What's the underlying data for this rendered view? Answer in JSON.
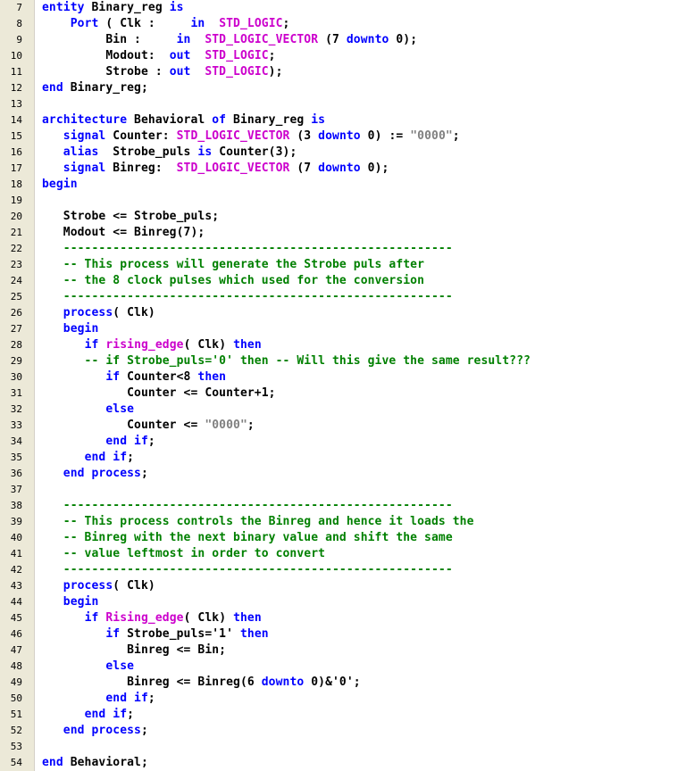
{
  "colors": {
    "keyword": "#0000ff",
    "type": "#cc00cc",
    "function": "#cc00cc",
    "string": "#808080",
    "comment": "#008000",
    "identifier": "#000000",
    "gutter_bg": "#ece9d8"
  },
  "editor": {
    "lines": [
      {
        "number": "7",
        "tokens": [
          [
            "kw",
            "entity"
          ],
          [
            "id",
            " Binary_reg "
          ],
          [
            "kw",
            "is"
          ]
        ]
      },
      {
        "number": "8",
        "tokens": [
          [
            "id",
            "    "
          ],
          [
            "kw",
            "Port"
          ],
          [
            "id",
            " ( Clk :     "
          ],
          [
            "kw",
            "in"
          ],
          [
            "id",
            "  "
          ],
          [
            "ty",
            "STD_LOGIC"
          ],
          [
            "op",
            ";"
          ]
        ]
      },
      {
        "number": "9",
        "tokens": [
          [
            "id",
            "         Bin :     "
          ],
          [
            "kw",
            "in"
          ],
          [
            "id",
            "  "
          ],
          [
            "ty",
            "STD_LOGIC_VECTOR"
          ],
          [
            "id",
            " (7 "
          ],
          [
            "kw",
            "downto"
          ],
          [
            "id",
            " 0);"
          ]
        ]
      },
      {
        "number": "10",
        "tokens": [
          [
            "id",
            "         Modout:  "
          ],
          [
            "kw",
            "out"
          ],
          [
            "id",
            "  "
          ],
          [
            "ty",
            "STD_LOGIC"
          ],
          [
            "op",
            ";"
          ]
        ]
      },
      {
        "number": "11",
        "tokens": [
          [
            "id",
            "         Strobe : "
          ],
          [
            "kw",
            "out"
          ],
          [
            "id",
            "  "
          ],
          [
            "ty",
            "STD_LOGIC"
          ],
          [
            "op",
            ");"
          ]
        ]
      },
      {
        "number": "12",
        "tokens": [
          [
            "kw",
            "end"
          ],
          [
            "id",
            " Binary_reg;"
          ]
        ]
      },
      {
        "number": "13",
        "tokens": []
      },
      {
        "number": "14",
        "tokens": [
          [
            "kw",
            "architecture"
          ],
          [
            "id",
            " Behavioral "
          ],
          [
            "kw",
            "of"
          ],
          [
            "id",
            " Binary_reg "
          ],
          [
            "kw",
            "is"
          ]
        ]
      },
      {
        "number": "15",
        "tokens": [
          [
            "id",
            "   "
          ],
          [
            "kw",
            "signal"
          ],
          [
            "id",
            " Counter: "
          ],
          [
            "ty",
            "STD_LOGIC_VECTOR"
          ],
          [
            "id",
            " (3 "
          ],
          [
            "kw",
            "downto"
          ],
          [
            "id",
            " 0) := "
          ],
          [
            "str",
            "\"0000\""
          ],
          [
            "op",
            ";"
          ]
        ]
      },
      {
        "number": "16",
        "tokens": [
          [
            "id",
            "   "
          ],
          [
            "kw",
            "alias"
          ],
          [
            "id",
            "  Strobe_puls "
          ],
          [
            "kw",
            "is"
          ],
          [
            "id",
            " Counter(3);"
          ]
        ]
      },
      {
        "number": "17",
        "tokens": [
          [
            "id",
            "   "
          ],
          [
            "kw",
            "signal"
          ],
          [
            "id",
            " Binreg:  "
          ],
          [
            "ty",
            "STD_LOGIC_VECTOR"
          ],
          [
            "id",
            " (7 "
          ],
          [
            "kw",
            "downto"
          ],
          [
            "id",
            " 0);"
          ]
        ]
      },
      {
        "number": "18",
        "tokens": [
          [
            "kw",
            "begin"
          ]
        ]
      },
      {
        "number": "19",
        "tokens": []
      },
      {
        "number": "20",
        "tokens": [
          [
            "id",
            "   Strobe <= Strobe_puls;"
          ]
        ]
      },
      {
        "number": "21",
        "tokens": [
          [
            "id",
            "   Modout <= Binreg(7);"
          ]
        ]
      },
      {
        "number": "22",
        "tokens": [
          [
            "cmt",
            "   -------------------------------------------------------"
          ]
        ]
      },
      {
        "number": "23",
        "tokens": [
          [
            "cmt",
            "   -- This process will generate the Strobe puls after"
          ]
        ]
      },
      {
        "number": "24",
        "tokens": [
          [
            "cmt",
            "   -- the 8 clock pulses which used for the conversion"
          ]
        ]
      },
      {
        "number": "25",
        "tokens": [
          [
            "cmt",
            "   -------------------------------------------------------"
          ]
        ]
      },
      {
        "number": "26",
        "tokens": [
          [
            "id",
            "   "
          ],
          [
            "kw",
            "process"
          ],
          [
            "id",
            "( Clk)"
          ]
        ]
      },
      {
        "number": "27",
        "tokens": [
          [
            "id",
            "   "
          ],
          [
            "kw",
            "begin"
          ]
        ]
      },
      {
        "number": "28",
        "tokens": [
          [
            "id",
            "      "
          ],
          [
            "kw",
            "if"
          ],
          [
            "id",
            " "
          ],
          [
            "fn",
            "rising_edge"
          ],
          [
            "id",
            "( Clk) "
          ],
          [
            "kw",
            "then"
          ]
        ]
      },
      {
        "number": "29",
        "tokens": [
          [
            "cmt",
            "      -- if Strobe_puls='0' then -- Will this give the same result???"
          ]
        ]
      },
      {
        "number": "30",
        "tokens": [
          [
            "id",
            "         "
          ],
          [
            "kw",
            "if"
          ],
          [
            "id",
            " Counter<8 "
          ],
          [
            "kw",
            "then"
          ]
        ]
      },
      {
        "number": "31",
        "tokens": [
          [
            "id",
            "            Counter <= Counter+1;"
          ]
        ]
      },
      {
        "number": "32",
        "tokens": [
          [
            "id",
            "         "
          ],
          [
            "kw",
            "else"
          ]
        ]
      },
      {
        "number": "33",
        "tokens": [
          [
            "id",
            "            Counter <= "
          ],
          [
            "str",
            "\"0000\""
          ],
          [
            "op",
            ";"
          ]
        ]
      },
      {
        "number": "34",
        "tokens": [
          [
            "id",
            "         "
          ],
          [
            "kw",
            "end if"
          ],
          [
            "op",
            ";"
          ]
        ]
      },
      {
        "number": "35",
        "tokens": [
          [
            "id",
            "      "
          ],
          [
            "kw",
            "end if"
          ],
          [
            "op",
            ";"
          ]
        ]
      },
      {
        "number": "36",
        "tokens": [
          [
            "id",
            "   "
          ],
          [
            "kw",
            "end process"
          ],
          [
            "op",
            ";"
          ]
        ]
      },
      {
        "number": "37",
        "tokens": []
      },
      {
        "number": "38",
        "tokens": [
          [
            "cmt",
            "   -------------------------------------------------------"
          ]
        ]
      },
      {
        "number": "39",
        "tokens": [
          [
            "cmt",
            "   -- This process controls the Binreg and hence it loads the"
          ]
        ]
      },
      {
        "number": "40",
        "tokens": [
          [
            "cmt",
            "   -- Binreg with the next binary value and shift the same"
          ]
        ]
      },
      {
        "number": "41",
        "tokens": [
          [
            "cmt",
            "   -- value leftmost in order to convert"
          ]
        ]
      },
      {
        "number": "42",
        "tokens": [
          [
            "cmt",
            "   -------------------------------------------------------"
          ]
        ]
      },
      {
        "number": "43",
        "tokens": [
          [
            "id",
            "   "
          ],
          [
            "kw",
            "process"
          ],
          [
            "id",
            "( Clk)"
          ]
        ]
      },
      {
        "number": "44",
        "tokens": [
          [
            "id",
            "   "
          ],
          [
            "kw",
            "begin"
          ]
        ]
      },
      {
        "number": "45",
        "tokens": [
          [
            "id",
            "      "
          ],
          [
            "kw",
            "if"
          ],
          [
            "id",
            " "
          ],
          [
            "fn",
            "Rising_edge"
          ],
          [
            "id",
            "( Clk) "
          ],
          [
            "kw",
            "then"
          ]
        ]
      },
      {
        "number": "46",
        "tokens": [
          [
            "id",
            "         "
          ],
          [
            "kw",
            "if"
          ],
          [
            "id",
            " Strobe_puls='1' "
          ],
          [
            "kw",
            "then"
          ]
        ]
      },
      {
        "number": "47",
        "tokens": [
          [
            "id",
            "            Binreg <= Bin;"
          ]
        ]
      },
      {
        "number": "48",
        "tokens": [
          [
            "id",
            "         "
          ],
          [
            "kw",
            "else"
          ]
        ]
      },
      {
        "number": "49",
        "tokens": [
          [
            "id",
            "            Binreg <= Binreg(6 "
          ],
          [
            "kw",
            "downto"
          ],
          [
            "id",
            " 0)&'0';"
          ]
        ]
      },
      {
        "number": "50",
        "tokens": [
          [
            "id",
            "         "
          ],
          [
            "kw",
            "end if"
          ],
          [
            "op",
            ";"
          ]
        ]
      },
      {
        "number": "51",
        "tokens": [
          [
            "id",
            "      "
          ],
          [
            "kw",
            "end if"
          ],
          [
            "op",
            ";"
          ]
        ]
      },
      {
        "number": "52",
        "tokens": [
          [
            "id",
            "   "
          ],
          [
            "kw",
            "end process"
          ],
          [
            "op",
            ";"
          ]
        ]
      },
      {
        "number": "53",
        "tokens": []
      },
      {
        "number": "54",
        "tokens": [
          [
            "kw",
            "end"
          ],
          [
            "id",
            " Behavioral;"
          ]
        ]
      }
    ]
  }
}
